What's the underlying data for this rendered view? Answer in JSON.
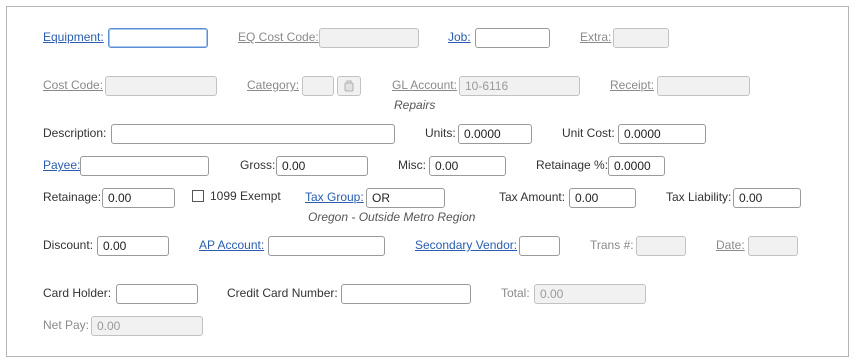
{
  "row1": {
    "equipment_label": "Equipment:",
    "equipment_value": "",
    "eq_cost_code_label": "EQ Cost Code:",
    "eq_cost_code_value": "",
    "job_label": "Job:",
    "job_value": "",
    "extra_label": "Extra:",
    "extra_value": ""
  },
  "row2": {
    "cost_code_label": "Cost Code:",
    "cost_code_value": "",
    "category_label": "Category:",
    "category_value": "",
    "category_lookup_icon": "lookup-icon",
    "gl_account_label": "GL Account:",
    "gl_account_value": "10-6116",
    "gl_account_note": "Repairs",
    "receipt_label": "Receipt:",
    "receipt_value": ""
  },
  "row3": {
    "description_label": "Description:",
    "description_value": "",
    "units_label": "Units:",
    "units_value": "0.0000",
    "unit_cost_label": "Unit Cost:",
    "unit_cost_value": "0.0000"
  },
  "row4": {
    "payee_label": "Payee:",
    "payee_value": "",
    "gross_label": "Gross:",
    "gross_value": "0.00",
    "misc_label": "Misc:",
    "misc_value": "0.00",
    "retainage_pct_label": "Retainage %:",
    "retainage_pct_value": "0.0000"
  },
  "row5": {
    "retainage_label": "Retainage:",
    "retainage_value": "0.00",
    "exempt_1099_label": "1099 Exempt",
    "exempt_1099_checked": false,
    "tax_group_label": "Tax Group:",
    "tax_group_value": "OR",
    "tax_group_note": "Oregon - Outside Metro Region",
    "tax_amount_label": "Tax Amount:",
    "tax_amount_value": "0.00",
    "tax_liability_label": "Tax Liability:",
    "tax_liability_value": "0.00"
  },
  "row6": {
    "discount_label": "Discount:",
    "discount_value": "0.00",
    "ap_account_label": "AP Account:",
    "ap_account_value": "",
    "secondary_vendor_label": "Secondary Vendor:",
    "secondary_vendor_value": "",
    "trans_label": "Trans #:",
    "trans_value": "",
    "date_label": "Date:",
    "date_value": ""
  },
  "row7": {
    "card_holder_label": "Card Holder:",
    "card_holder_value": "",
    "credit_card_label": "Credit Card Number:",
    "credit_card_value": "",
    "total_label": "Total:",
    "total_value": "0.00"
  },
  "row8": {
    "net_pay_label": "Net Pay:",
    "net_pay_value": "0.00"
  }
}
